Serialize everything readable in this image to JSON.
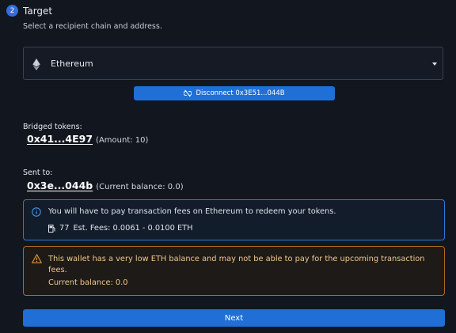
{
  "step": {
    "number": "2",
    "title": "Target"
  },
  "subtitle": "Select a recipient chain and address.",
  "chain_select": {
    "value": "Ethereum",
    "icon": "ethereum-icon"
  },
  "disconnect": {
    "label": "Disconnect 0x3E51...044B",
    "icon": "unlink-icon"
  },
  "bridged": {
    "label": "Bridged tokens:",
    "address": "0x41...4E97",
    "meta": "(Amount: 10)"
  },
  "sent_to": {
    "label": "Sent to:",
    "address": "0x3e...044b",
    "meta": "(Current balance: 0.0)"
  },
  "info": {
    "message": "You will have to pay transaction fees on Ethereum to redeem your tokens.",
    "gas_value": "77",
    "fees": "Est. Fees: 0.0061 - 0.0100 ETH"
  },
  "warning": {
    "message": "This wallet has a very low ETH balance and may not be able to pay for the upcoming transaction fees.",
    "balance": "Current balance: 0.0"
  },
  "next_label": "Next",
  "colors": {
    "accent": "#1f6fd6",
    "info_border": "#2b7ad6",
    "warn_border": "#b06a1f",
    "warn_text": "#f0c88e",
    "background": "#12161f"
  }
}
